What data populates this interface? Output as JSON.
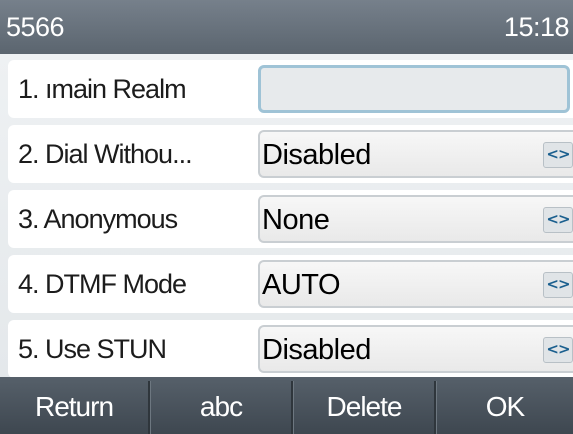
{
  "status_bar": {
    "account": "5566",
    "time": "15:18"
  },
  "rows": [
    {
      "label": "1.  ımain Realm",
      "value": "",
      "has_arrows": false,
      "active": true
    },
    {
      "label": "2.  Dial Withou...",
      "value": "Disabled",
      "has_arrows": true
    },
    {
      "label": "3.  Anonymous",
      "value": "None",
      "has_arrows": true
    },
    {
      "label": "4.  DTMF Mode",
      "value": "AUTO",
      "has_arrows": true
    },
    {
      "label": "5.  Use STUN",
      "value": "Disabled",
      "has_arrows": true
    }
  ],
  "arrow_glyph": "<>",
  "softkeys": [
    "Return",
    "abc",
    "Delete",
    "OK"
  ],
  "colors": {
    "status_bar": "#5b656f",
    "softkey_bar": "#3e4750",
    "active_field_border": "#9fc3d6",
    "arrow_color": "#1a5f8e"
  }
}
